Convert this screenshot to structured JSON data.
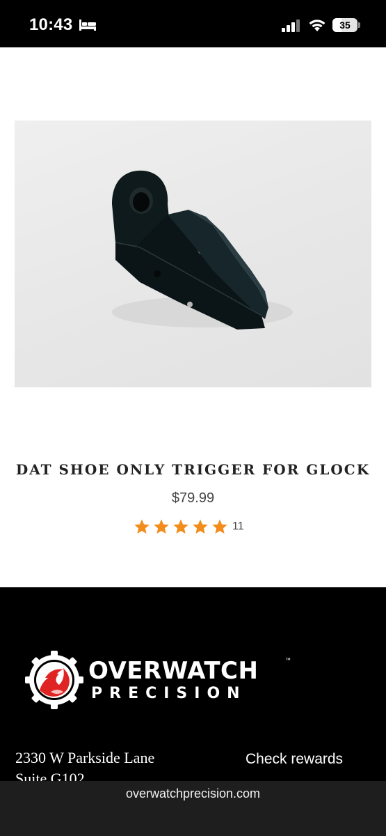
{
  "status_bar": {
    "time": "10:43",
    "battery_level": "35",
    "icons": [
      "bed-icon",
      "signal-icon",
      "wifi-icon",
      "battery-icon"
    ]
  },
  "product": {
    "image_alt": "black trigger shoe on white background",
    "title": "DAT SHOE ONLY TRIGGER FOR GLOCK",
    "price": "$79.99",
    "rating": 5,
    "review_count": "11",
    "star_color": "#f28c1b"
  },
  "footer": {
    "logo_word1": "OVERWATCH",
    "logo_word2": "PRECISION",
    "logo_tm": "™",
    "address_line1": "2330 W Parkside Lane",
    "address_line2": "Suite G102",
    "rewards_label": "Check rewards",
    "brand_red": "#e02424"
  },
  "browser": {
    "url": "overwatchprecision.com"
  }
}
